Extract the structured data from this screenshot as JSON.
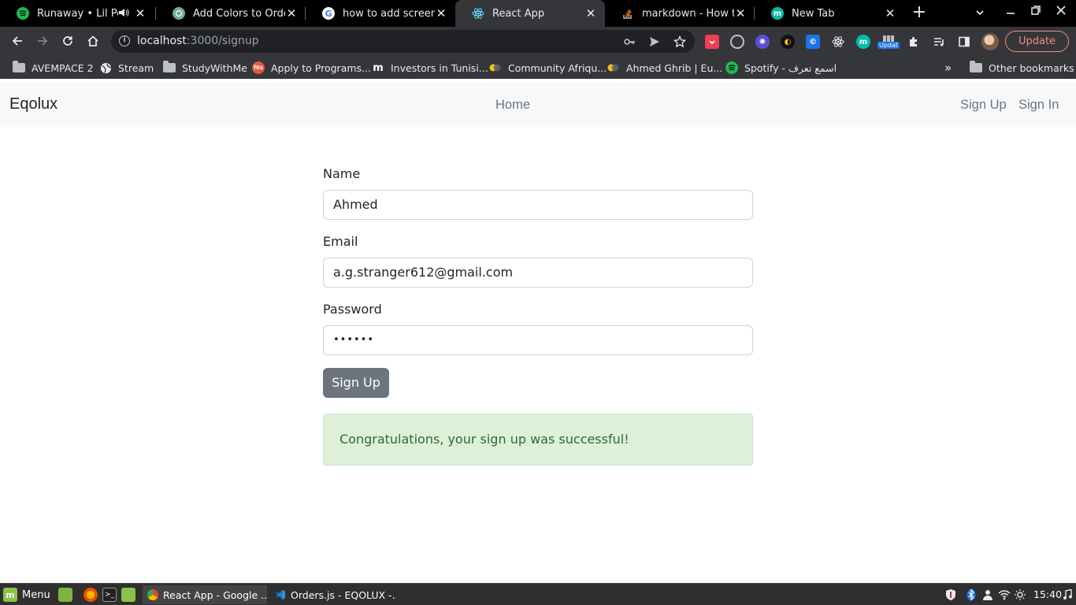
{
  "browser": {
    "tabs": [
      {
        "title": "Runaway • Lil Peep",
        "icon": "spotify-icon",
        "audio": true,
        "active": false
      },
      {
        "title": "Add Colors to Orders",
        "icon": "chatgpt-icon",
        "audio": false,
        "active": false
      },
      {
        "title": "how to add screenshot",
        "icon": "google-icon",
        "audio": false,
        "active": false
      },
      {
        "title": "React App",
        "icon": "react-icon",
        "audio": false,
        "active": true
      },
      {
        "title": "markdown - How to add",
        "icon": "stackoverflow-icon",
        "audio": false,
        "active": false
      },
      {
        "title": "New Tab",
        "icon": "m-icon",
        "audio": false,
        "active": false
      }
    ],
    "address": {
      "host": "localhost",
      "path": ":3000/signup"
    },
    "update_label": "Update",
    "extension_badge": "Updat",
    "bookmarks": [
      {
        "label": "AVEMPACE 2",
        "icon": "folder-icon"
      },
      {
        "label": "Stream",
        "icon": "globe-icon"
      },
      {
        "label": "StudyWithMe",
        "icon": "folder-icon"
      },
      {
        "label": "Apply to Programs...",
        "icon": "f6s-icon"
      },
      {
        "label": "Investors in Tunisi...",
        "icon": "m-logo-icon"
      },
      {
        "label": "Community Afriqu...",
        "icon": "community-icon"
      },
      {
        "label": "Ahmed Ghrib | Eu...",
        "icon": "community-icon"
      },
      {
        "label": "Spotify - اسمع تعرف",
        "icon": "spotify-icon"
      }
    ],
    "other_bookmarks": "Other bookmarks",
    "chevron": "»"
  },
  "app": {
    "brand": "Eqolux",
    "nav": {
      "home": "Home",
      "sign_up": "Sign Up",
      "sign_in": "Sign In"
    },
    "form": {
      "name_label": "Name",
      "name_value": "Ahmed",
      "email_label": "Email",
      "email_value": "a.g.stranger612@gmail.com",
      "password_label": "Password",
      "password_value": "••••••",
      "submit_label": "Sign Up"
    },
    "alert": "Congratulations, your sign up was successful!"
  },
  "taskbar": {
    "menu_label": "Menu",
    "tasks": [
      {
        "title": "React App - Google ...",
        "active": true
      },
      {
        "title": "Orders.js - EQOLUX -...",
        "active": false
      }
    ],
    "clock": "15:40"
  },
  "colors": {
    "tab_strip": "#000000",
    "toolbar": "#35363a",
    "navbar_bg": "#f8f9fa",
    "button": "#6c757d",
    "alert_bg": "#dff0d8",
    "alert_text": "#2d6a3e",
    "update_accent": "#f28b82"
  }
}
